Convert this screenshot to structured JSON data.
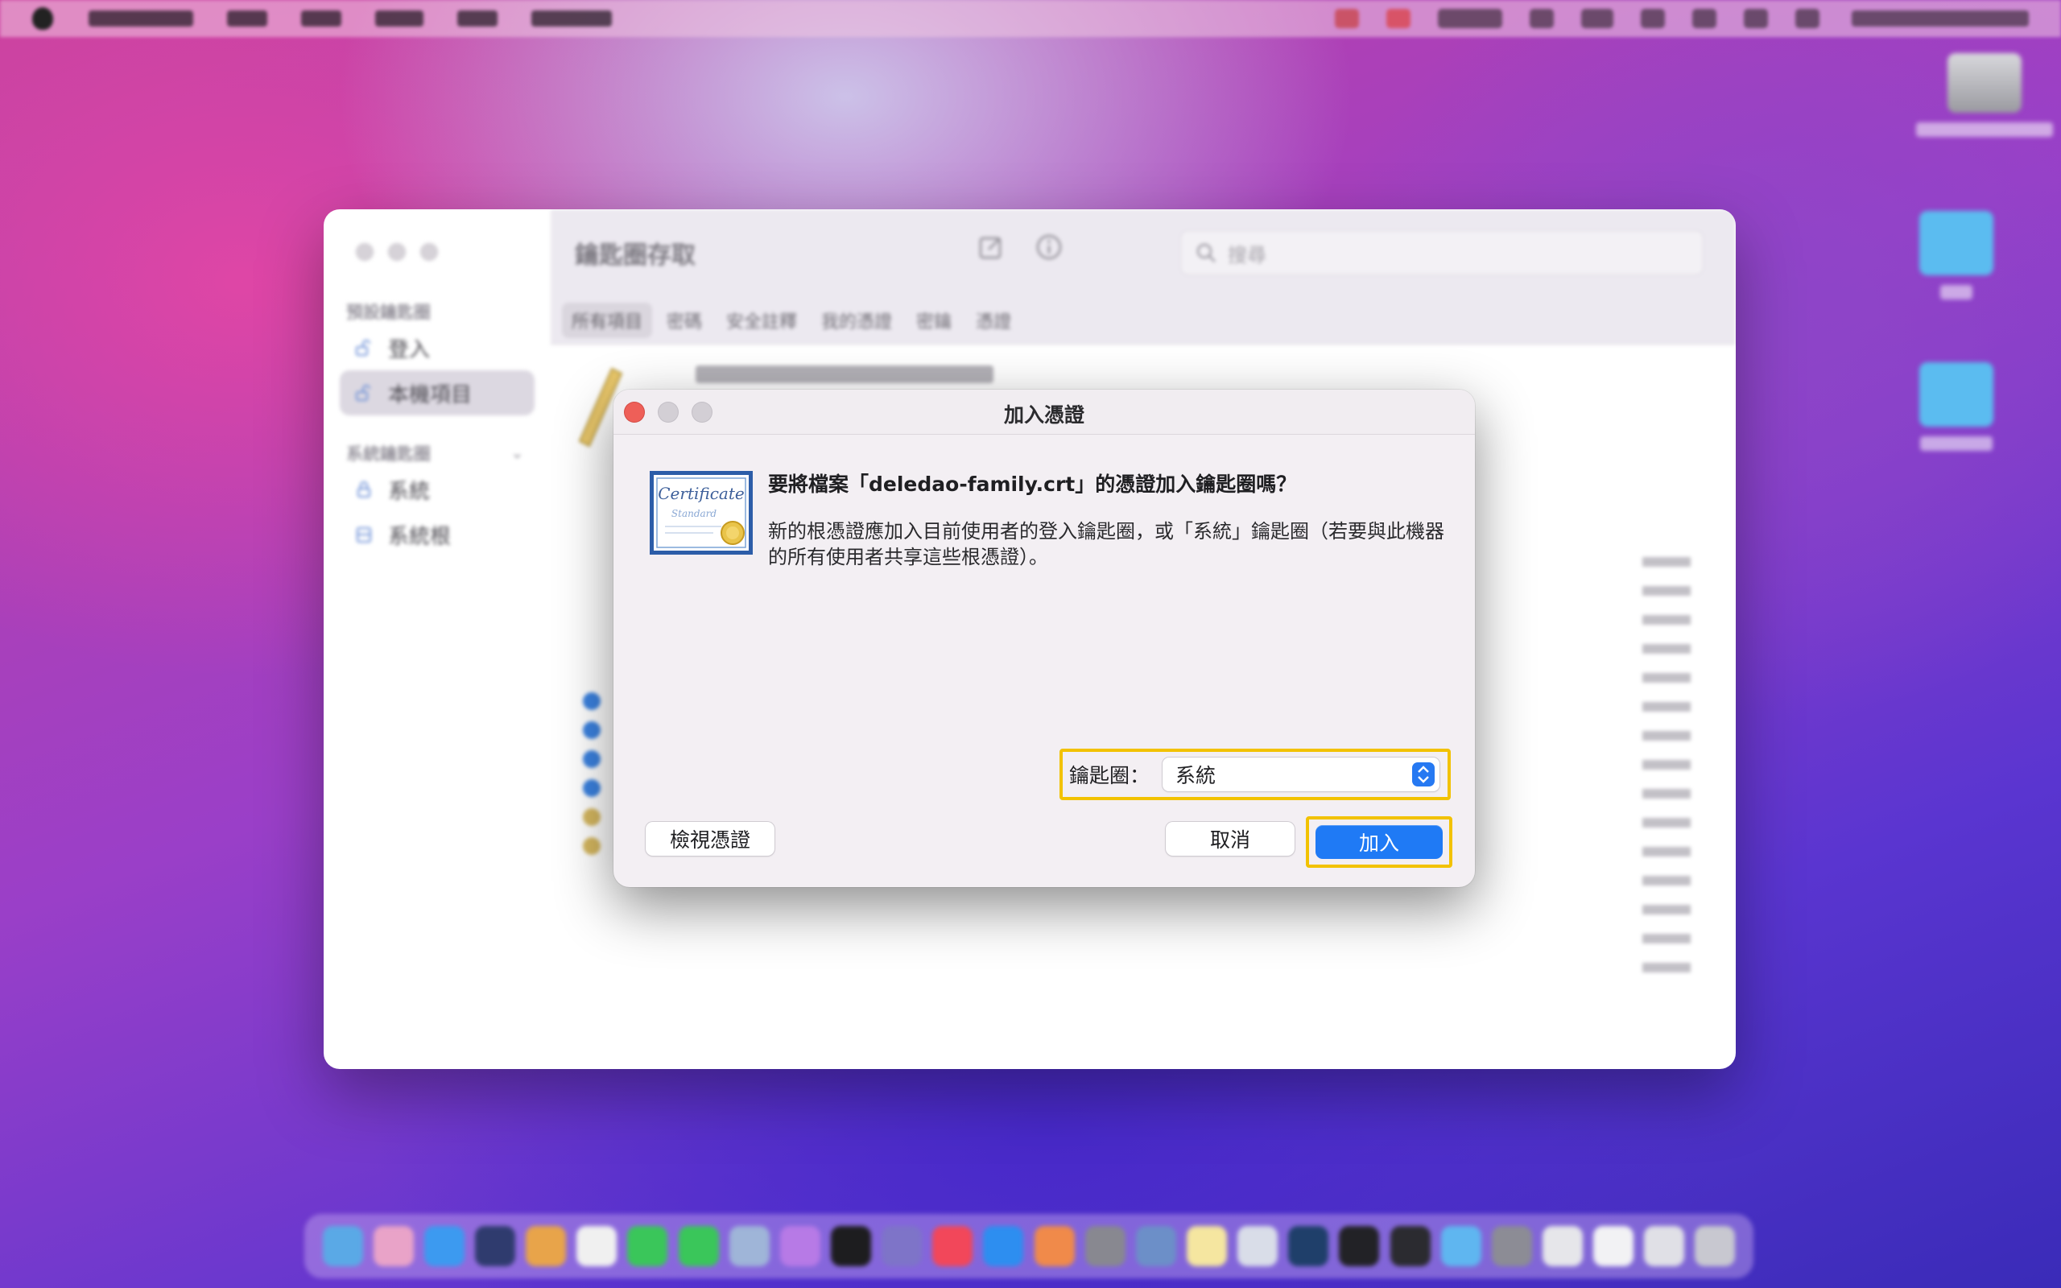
{
  "window": {
    "title": "鑰匙圈存取",
    "search_placeholder": "搜尋",
    "tabs": [
      "所有項目",
      "密碼",
      "安全註釋",
      "我的憑證",
      "密鑰",
      "憑證"
    ],
    "sidebar": {
      "default_section": "預設鑰匙圈",
      "default_items": [
        {
          "label": "登入",
          "icon": "unlocked-icon"
        },
        {
          "label": "本機項目",
          "icon": "unlocked-icon"
        }
      ],
      "system_section": "系統鑰匙圈",
      "system_items": [
        {
          "label": "系統",
          "icon": "lock-icon"
        },
        {
          "label": "系統根",
          "icon": "cabinet-icon"
        }
      ]
    }
  },
  "dialog": {
    "title": "加入憑證",
    "message_title": "要將檔案「deledao-family.crt」的憑證加入鑰匙圈嗎？",
    "message_body": "新的根憑證應加入目前使用者的登入鑰匙圈，或「系統」鑰匙圈（若要與此機器的所有使用者共享這些根憑證）。",
    "keychain_label": "鑰匙圈：",
    "keychain_value": "系統",
    "view_button": "檢視憑證",
    "cancel_button": "取消",
    "add_button": "加入",
    "cert_icon_text_top": "Certificate",
    "cert_icon_text_bottom": "Standard"
  },
  "colors": {
    "accent": "#1f7af5",
    "highlight": "#f2c200",
    "close": "#ee5f58",
    "inactive_light": "#cfcbd1"
  }
}
